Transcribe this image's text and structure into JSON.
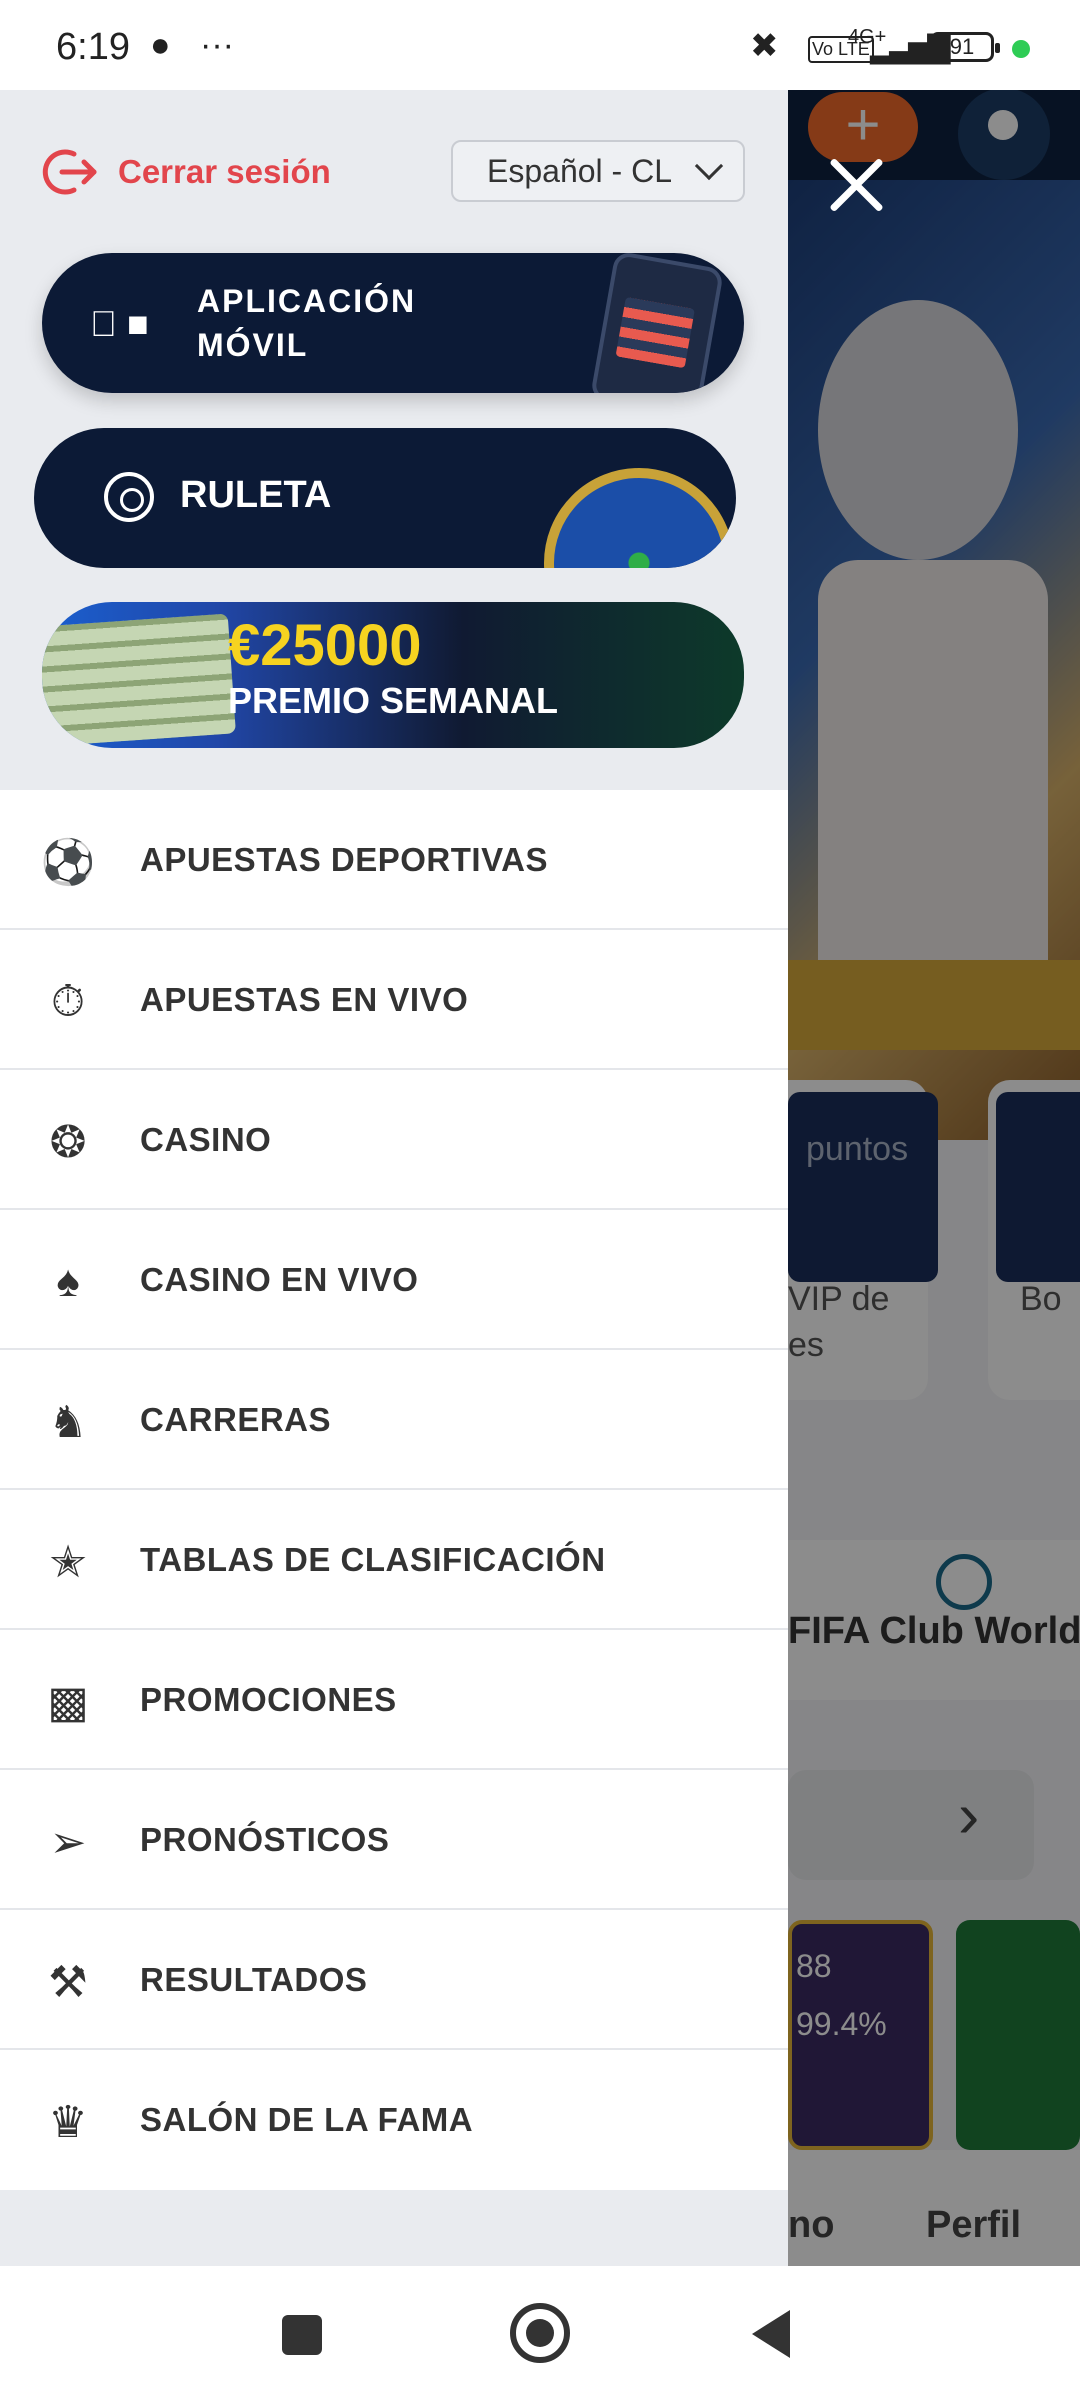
{
  "status_bar": {
    "time": "6:19",
    "battery": "91",
    "network": "4G+",
    "volte": "Vo LTE"
  },
  "drawer": {
    "logout_label": "Cerrar sesión",
    "language": "Español - CL",
    "banners": {
      "app": {
        "line1": "APLICACIÓN",
        "line2": "MÓVIL"
      },
      "roulette": {
        "label": "RULETA"
      },
      "prize": {
        "amount": "€25000",
        "label": "PREMIO SEMANAL"
      }
    },
    "menu": [
      {
        "label": "APUESTAS DEPORTIVAS",
        "icon": "soccer-ball-icon"
      },
      {
        "label": "APUESTAS EN VIVO",
        "icon": "stopwatch-icon"
      },
      {
        "label": "CASINO",
        "icon": "roulette-icon"
      },
      {
        "label": "CASINO EN VIVO",
        "icon": "cards-icon"
      },
      {
        "label": "CARRERAS",
        "icon": "horse-icon"
      },
      {
        "label": "TABLAS DE CLASIFICACIÓN",
        "icon": "star-laurel-icon"
      },
      {
        "label": "PROMOCIONES",
        "icon": "gift-icon"
      },
      {
        "label": "PRONÓSTICOS",
        "icon": "cursor-icon"
      },
      {
        "label": "RESULTADOS",
        "icon": "crossed-hammers-icon"
      },
      {
        "label": "SALÓN DE LA FAMA",
        "icon": "crown-icon"
      }
    ]
  },
  "background_app": {
    "card_text_1": "puntos",
    "card_text_2": "VIP de",
    "card_text_3": "es",
    "card_text_4": "Bo",
    "tab_label": "FIFA Club World C",
    "game_stat_1": "88",
    "game_stat_2": "99.4%",
    "nav_label_1": "no",
    "nav_label_2": "Perfil"
  },
  "colors": {
    "accent_red": "#e2454c",
    "banner_navy": "#0c1a36",
    "prize_yellow": "#f6d320"
  }
}
